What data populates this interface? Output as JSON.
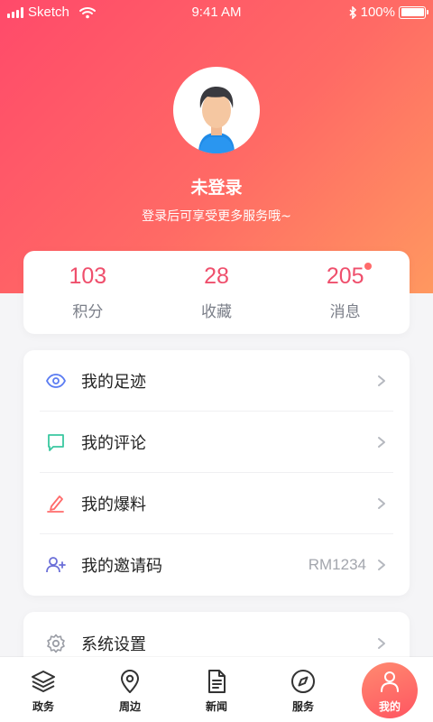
{
  "status_bar": {
    "carrier": "Sketch",
    "time": "9:41 AM",
    "battery": "100%"
  },
  "profile": {
    "name": "未登录",
    "hint": "登录后可享受更多服务哦~"
  },
  "stats": [
    {
      "value": "103",
      "label": "积分"
    },
    {
      "value": "28",
      "label": "收藏"
    },
    {
      "value": "205",
      "label": "消息",
      "has_dot": true
    }
  ],
  "menu": {
    "items": [
      {
        "label": "我的足迹",
        "icon": "eye-icon"
      },
      {
        "label": "我的评论",
        "icon": "comment-icon"
      },
      {
        "label": "我的爆料",
        "icon": "edit-icon"
      },
      {
        "label": "我的邀请码",
        "icon": "add-user-icon",
        "value": "RM1234"
      }
    ]
  },
  "settings": {
    "label": "系统设置",
    "icon": "gear-icon"
  },
  "tabbar": {
    "tabs": [
      {
        "label": "政务",
        "icon": "layers-icon"
      },
      {
        "label": "周边",
        "icon": "location-pin-icon"
      },
      {
        "label": "新闻",
        "icon": "document-icon"
      },
      {
        "label": "服务",
        "icon": "compass-icon"
      },
      {
        "label": "我的",
        "icon": "user-icon",
        "active": true
      }
    ]
  },
  "colors": {
    "accent": "#ef4f6c",
    "hero_start": "#ff4a6a",
    "hero_end": "#ff9860",
    "eye_icon": "#5b7cf2",
    "comment_icon": "#3ac8a0",
    "edit_icon": "#ff6b6b",
    "add_user_icon": "#6b6fd8"
  }
}
